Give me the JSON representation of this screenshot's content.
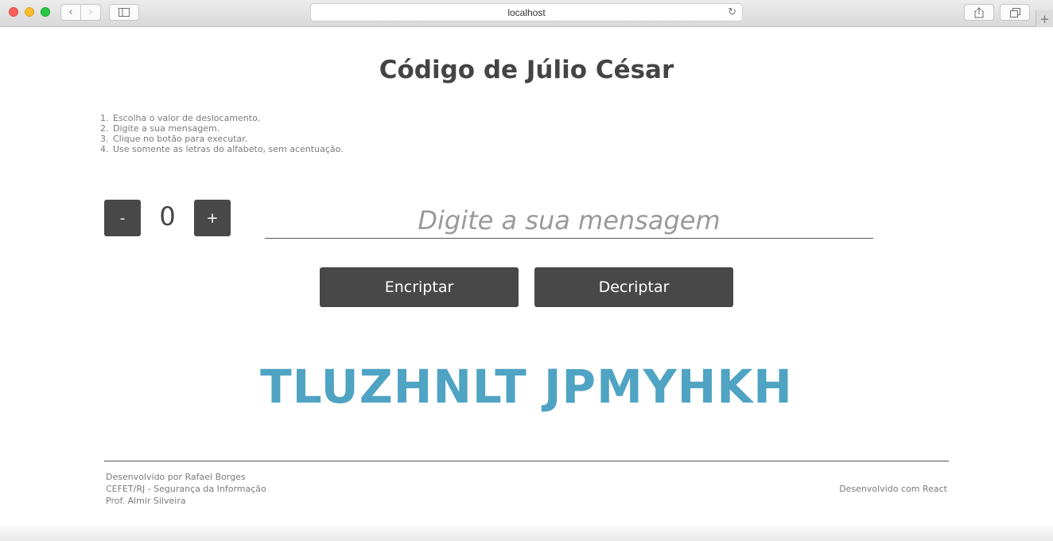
{
  "browser": {
    "url": "localhost",
    "icons": {
      "back": "chevron-left-icon",
      "forward": "chevron-right-icon",
      "sidebar": "sidebar-icon",
      "reload": "reload-icon",
      "share": "share-icon",
      "tabs": "tabs-icon",
      "new_tab": "plus-icon"
    }
  },
  "page": {
    "title": "Código de Júlio César",
    "instructions": [
      {
        "num": "1.",
        "text": "Escolha o valor de deslocamento."
      },
      {
        "num": "2.",
        "text": "Digite a sua mensagem."
      },
      {
        "num": "3.",
        "text": "Clique no botão para executar."
      },
      {
        "num": "4.",
        "text": "Use somente as letras do alfabeto, sem acentuação."
      }
    ]
  },
  "controls": {
    "decrement_label": "-",
    "shift_value": "0",
    "increment_label": "+",
    "message_placeholder": "Digite a sua mensagem",
    "message_value": "",
    "encrypt_label": "Encriptar",
    "decrypt_label": "Decriptar"
  },
  "result": {
    "text": "TLUZHNLT JPMYHKH"
  },
  "footer": {
    "left_lines": [
      "Desenvolvido por Rafael Borges",
      "CEFET/RJ - Segurança da Informação",
      "Prof. Almir Silveira"
    ],
    "right_text": "Desenvolvido com React"
  },
  "colors": {
    "button_bg": "#484848",
    "result_accent": "#4fa3c3",
    "title_text": "#444444"
  }
}
